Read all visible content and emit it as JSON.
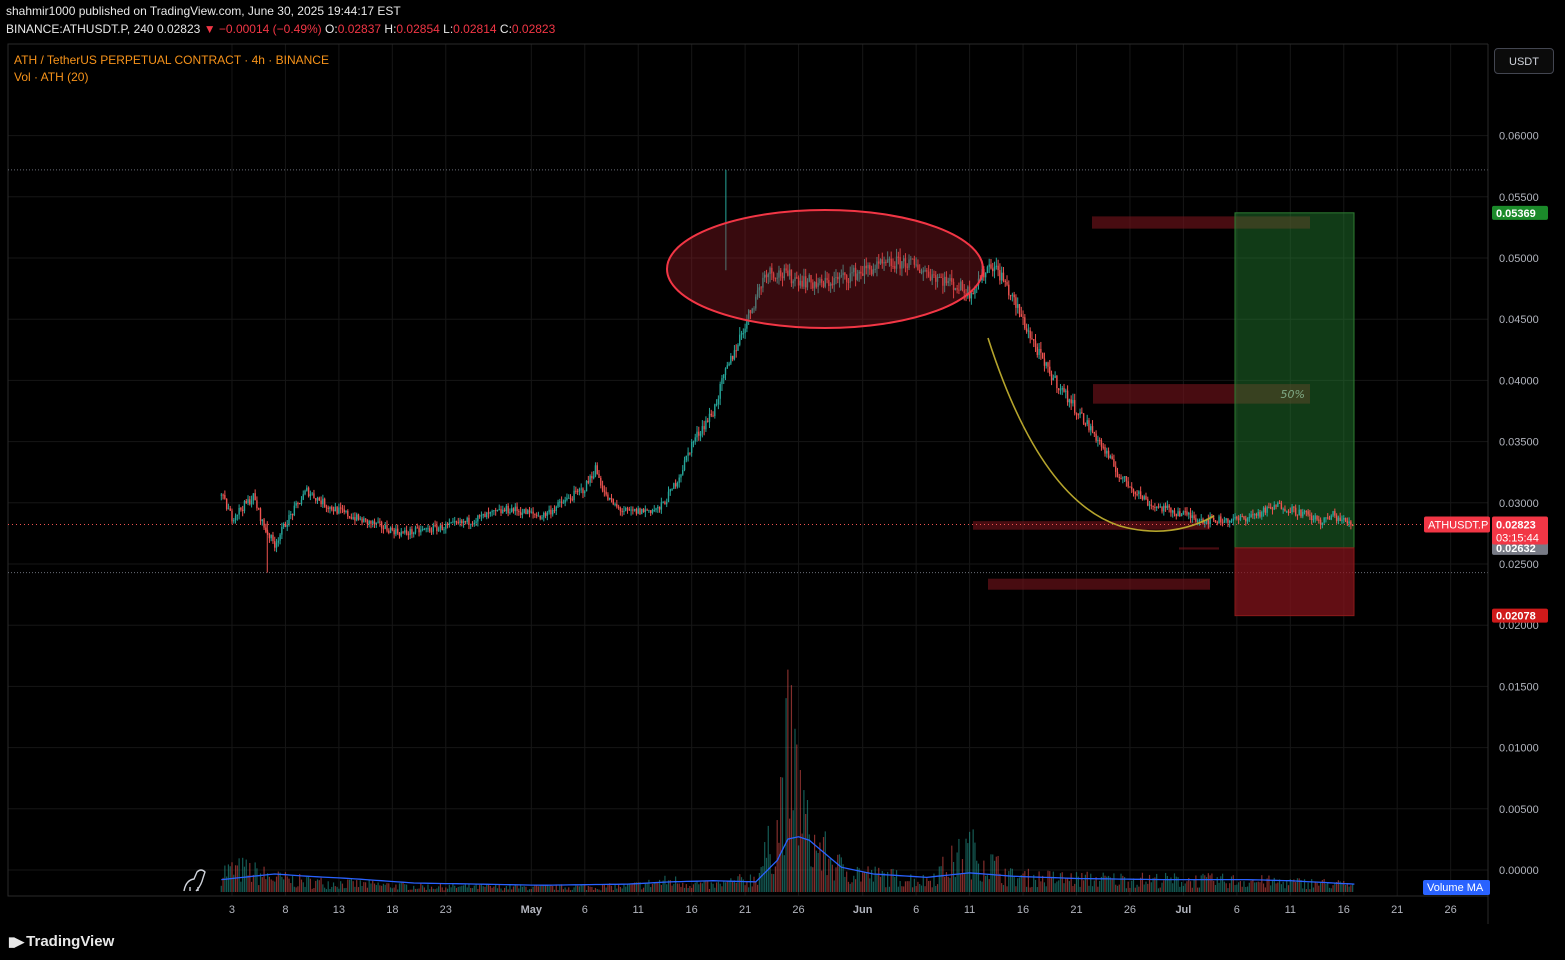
{
  "header": {
    "line1": "shahmir1000 published on TradingView.com, June 30, 2025 19:44:17 EST",
    "symbol_line": "BINANCE:ATHUSDT.P, 240",
    "last": "0.02823",
    "change_arrow": "▼",
    "change": "−0.00014 (−0.49%)",
    "o_label": "O:",
    "o": "0.02837",
    "h_label": "H:",
    "h": "0.02854",
    "l_label": "L:",
    "l": "0.02814",
    "c_label": "C:",
    "c": "0.02823"
  },
  "pane": {
    "title": "ATH / TetherUS PERPETUAL CONTRACT · 4h · BINANCE",
    "volume_title": "Vol · ATH (20)",
    "currency_button": "USDT",
    "volume_ma_label": "Volume MA"
  },
  "footer": {
    "brand": "TradingView"
  },
  "colors": {
    "up": "#26a69a",
    "down": "#ef5350",
    "volume_ma": "#2962ff",
    "ellipse": "#f23645",
    "arc": "#b5a42c",
    "accent": "#f7931a"
  },
  "chart_data": {
    "type": "candlestick",
    "title": "ATH / TetherUS PERPETUAL CONTRACT · 4h · BINANCE",
    "x_tick_labels": [
      "3",
      "8",
      "13",
      "18",
      "23",
      "May",
      "6",
      "11",
      "16",
      "21",
      "26",
      "Jun",
      "6",
      "11",
      "16",
      "21",
      "26",
      "Jul",
      "6",
      "11",
      "16",
      "21",
      "26"
    ],
    "y_tick_labels": [
      "0.06000",
      "0.05500",
      "0.05000",
      "0.04500",
      "0.04000",
      "0.03500",
      "0.03000",
      "0.02500",
      "0.02000",
      "0.01500",
      "0.01000",
      "0.00500",
      "0.00000"
    ],
    "ylim": [
      -0.0002,
      0.0635
    ],
    "price_path": {
      "x_days": [
        0,
        1,
        3,
        4,
        5,
        6,
        8,
        10,
        13,
        17,
        22,
        27,
        30,
        34,
        35,
        36,
        37,
        38,
        41,
        42,
        43,
        44,
        45,
        46,
        47,
        51,
        56,
        61,
        64,
        70,
        72,
        73,
        75,
        77,
        82,
        84,
        87,
        92,
        95,
        97,
        99,
        101,
        103,
        104,
        105,
        106
      ],
      "close": [
        0.0306,
        0.0288,
        0.0305,
        0.028,
        0.0266,
        0.0283,
        0.031,
        0.0297,
        0.0286,
        0.0275,
        0.0282,
        0.0295,
        0.0289,
        0.0312,
        0.0328,
        0.0305,
        0.0296,
        0.0292,
        0.0295,
        0.0308,
        0.0325,
        0.0348,
        0.0362,
        0.0374,
        0.0402,
        0.049,
        0.0478,
        0.0492,
        0.0497,
        0.0472,
        0.0496,
        0.0485,
        0.0449,
        0.0412,
        0.0352,
        0.0322,
        0.0298,
        0.0286,
        0.0286,
        0.0291,
        0.0298,
        0.0292,
        0.0284,
        0.029,
        0.0285,
        0.0282
      ]
    },
    "period_high": 0.0572,
    "period_low": 0.0243,
    "last_price": 0.02823,
    "last_price_label": "ATHUSDT.P",
    "countdown": "03:15:44",
    "position": {
      "entry": 0.02632,
      "target": 0.05369,
      "stop": 0.02078,
      "target_label": "0.05369",
      "entry_label": "0.02632",
      "stop_label": "0.02078"
    },
    "zones": [
      {
        "from": 0.0524,
        "to": 0.0534
      },
      {
        "from": 0.0381,
        "to": 0.0397,
        "label": "50%"
      },
      {
        "from": 0.0278,
        "to": 0.0285
      },
      {
        "from": 0.0229,
        "to": 0.0238
      },
      {
        "from": 0.02618,
        "to": 0.02636
      }
    ],
    "horizontal_lines": [
      0.0572,
      0.0243
    ],
    "volume": {
      "x_days": [
        0,
        2,
        5,
        8,
        12,
        18,
        30,
        38,
        42,
        46,
        50,
        52,
        53,
        54,
        55,
        58,
        61,
        66,
        70,
        74,
        80,
        88,
        96,
        100,
        104,
        106
      ],
      "values": [
        0.0022,
        0.0024,
        0.0015,
        0.0011,
        0.0009,
        0.0006,
        0.0005,
        0.0006,
        0.0012,
        0.0007,
        0.0015,
        0.0065,
        0.0152,
        0.011,
        0.0055,
        0.0025,
        0.0018,
        0.0012,
        0.0045,
        0.0016,
        0.0014,
        0.0013,
        0.0012,
        0.001,
        0.0009,
        0.0007
      ],
      "ma": [
        0.0011,
        0.0013,
        0.0016,
        0.0014,
        0.0012,
        0.0008,
        0.0006,
        0.0007,
        0.0009,
        0.001,
        0.0009,
        0.0028,
        0.0047,
        0.0049,
        0.0046,
        0.0022,
        0.0016,
        0.0013,
        0.0017,
        0.0014,
        0.0012,
        0.0011,
        0.0011,
        0.001,
        0.0008,
        0.0007
      ]
    },
    "grid": true,
    "legend": "top-left"
  }
}
